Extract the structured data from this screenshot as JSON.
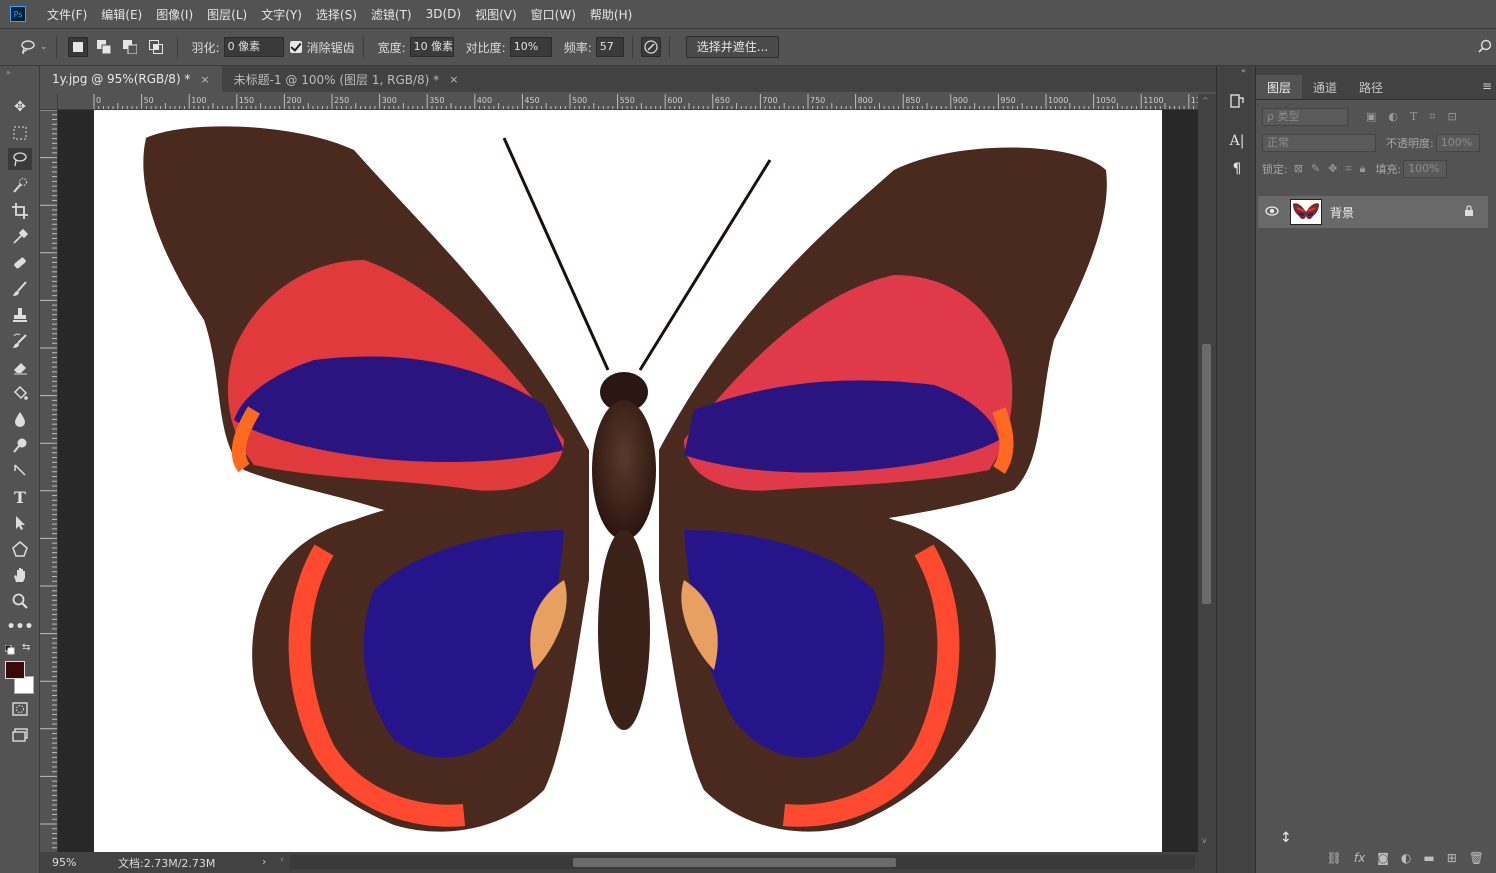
{
  "menubar": {
    "logo": "Ps",
    "items": [
      "文件(F)",
      "编辑(E)",
      "图像(I)",
      "图层(L)",
      "文字(Y)",
      "选择(S)",
      "滤镜(T)",
      "3D(D)",
      "视图(V)",
      "窗口(W)",
      "帮助(H)"
    ]
  },
  "options": {
    "feather_label": "羽化:",
    "feather_value": "0 像素",
    "antialias_label": "消除锯齿",
    "width_label": "宽度:",
    "width_value": "10 像素",
    "contrast_label": "对比度:",
    "contrast_value": "10%",
    "frequency_label": "频率:",
    "frequency_value": "57",
    "select_mask_label": "选择并遮住..."
  },
  "tabs": [
    {
      "title": "1y.jpg @ 95%(RGB/8) *",
      "close": "×"
    },
    {
      "title": "未标题-1 @ 100% (图层 1, RGB/8) *",
      "close": "×"
    }
  ],
  "ruler": {
    "top_ticks": [
      "0",
      "50",
      "100",
      "150",
      "200",
      "250",
      "300",
      "350",
      "400",
      "450",
      "500",
      "550",
      "600",
      "650",
      "700",
      "750",
      "800",
      "850",
      "900",
      "950",
      "1000",
      "1050",
      "1100",
      "11"
    ]
  },
  "status": {
    "zoom": "95%",
    "doc_info": "文档:2.73M/2.73M",
    "arrow": "›"
  },
  "layers_panel": {
    "tabs": [
      "图层",
      "通道",
      "路径"
    ],
    "filter_placeholder": "ρ 类型",
    "blend_mode": "正常",
    "opacity_label": "不透明度:",
    "opacity_value": "100%",
    "lock_label": "锁定:",
    "fill_label": "填充:",
    "fill_value": "100%",
    "layers": [
      {
        "name": "背景"
      }
    ]
  },
  "colors": {
    "foreground": "#3a0a0a",
    "background": "#ffffff",
    "accent": "#31a8ff"
  }
}
